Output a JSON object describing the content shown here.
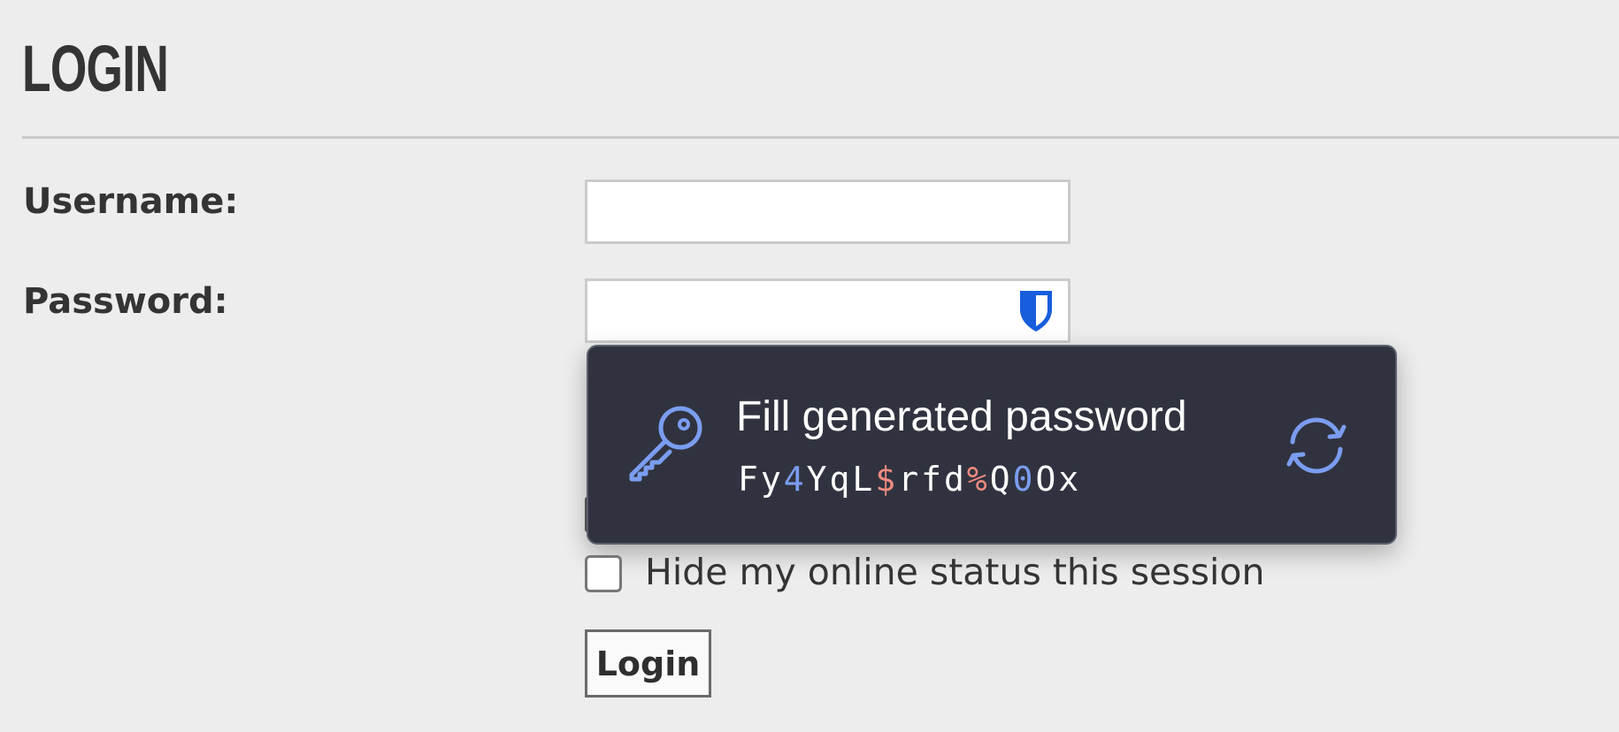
{
  "page": {
    "title": "LOGIN"
  },
  "form": {
    "username_label": "Username:",
    "username_value": "",
    "password_label": "Password:",
    "password_value": "",
    "hide_status_label": "Hide my online status this session",
    "hide_status_checked": false,
    "login_button": "Login"
  },
  "autofill_popup": {
    "title": "Fill generated password",
    "generated_password": [
      {
        "text": "Fy",
        "kind": "letter"
      },
      {
        "text": "4",
        "kind": "number"
      },
      {
        "text": "YqL",
        "kind": "letter"
      },
      {
        "text": "$",
        "kind": "symbol"
      },
      {
        "text": "rfd",
        "kind": "letter"
      },
      {
        "text": "%",
        "kind": "symbol"
      },
      {
        "text": "Q",
        "kind": "letter"
      },
      {
        "text": "0",
        "kind": "number"
      },
      {
        "text": "Ox",
        "kind": "letter"
      }
    ],
    "icons": {
      "leading": "key-icon",
      "trailing": "refresh-icon",
      "field": "bitwarden-shield-icon"
    }
  },
  "colors": {
    "background": "#ededed",
    "popup_background": "#30333f",
    "accent_blue": "#7b9df0",
    "symbol_red": "#ee8a80",
    "shield_blue": "#175ddc"
  }
}
